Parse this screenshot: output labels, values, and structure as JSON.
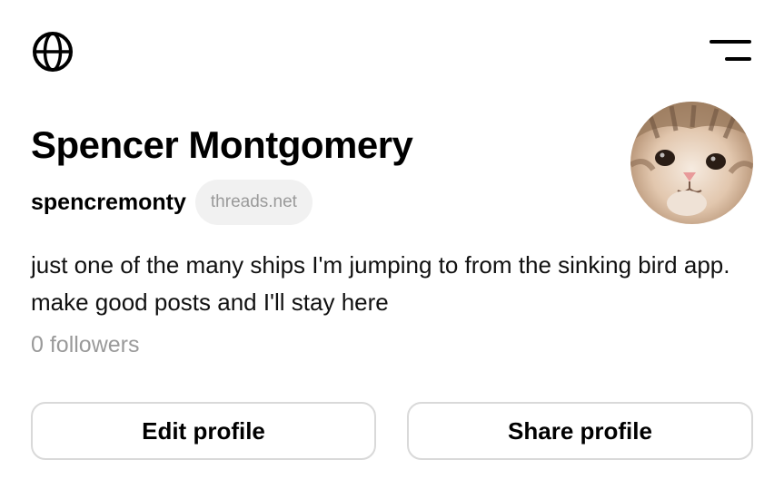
{
  "header": {
    "left_icon": "globe-icon",
    "right_icon": "menu-icon"
  },
  "profile": {
    "display_name": "Spencer Montgomery",
    "username": "spencremonty",
    "domain_badge": "threads.net",
    "bio": "just one of the many ships I'm jumping to from the sinking bird app. make good posts and I'll stay here",
    "followers": "0 followers",
    "avatar": "cat-avatar"
  },
  "actions": {
    "edit_label": "Edit profile",
    "share_label": "Share profile"
  },
  "colors": {
    "text": "#000000",
    "muted": "#9a9a9a",
    "badge_bg": "#f1f1f1",
    "button_border": "#d9d9d9"
  }
}
